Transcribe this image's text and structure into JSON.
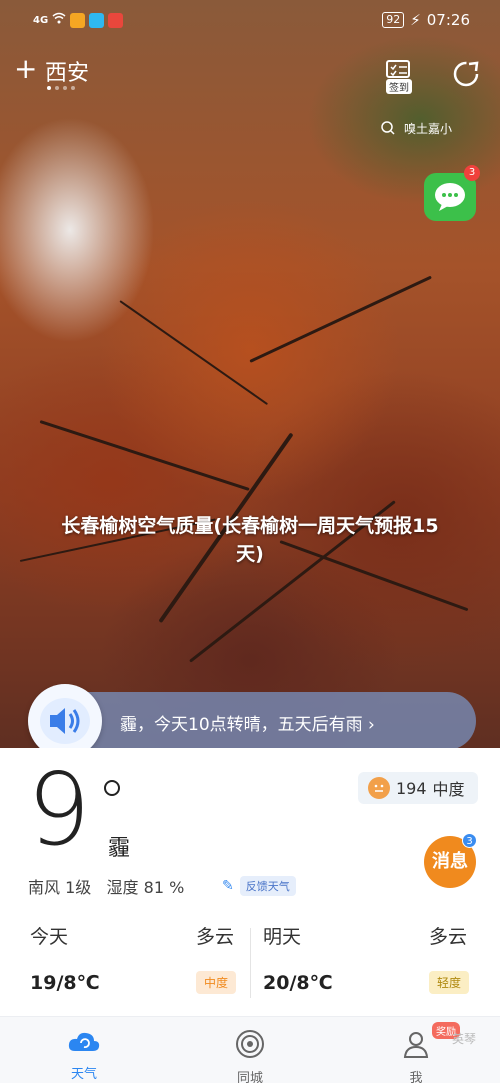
{
  "status_bar": {
    "signal": "4G",
    "battery": "92",
    "time": "07:26"
  },
  "header": {
    "add_symbol": "+",
    "city": "西安",
    "signin_label": "签到",
    "search_text": "嗅土嘉小",
    "chat_badge": "3"
  },
  "headline": "长春榆树空气质量(长春榆树一周天气预报15天)",
  "banner": {
    "text": "霾，今天10点转晴，五天后有雨 ›"
  },
  "current": {
    "temperature": "9",
    "condition": "霾",
    "aqi_value": "194",
    "aqi_level": "中度",
    "wind": "南风 1级",
    "humidity": "湿度 81 %",
    "feedback_label": "反馈天气",
    "message_label": "消息",
    "message_badge": "3"
  },
  "forecast": [
    {
      "day": "今天",
      "condition": "多云",
      "temps": "19/8℃",
      "aqi": "中度",
      "aqi_color": "#f08a1e",
      "aqi_bg": "#fde9d4"
    },
    {
      "day": "明天",
      "condition": "多云",
      "temps": "20/8℃",
      "aqi": "轻度",
      "aqi_color": "#b08a10",
      "aqi_bg": "#fbeec4"
    }
  ],
  "bottom_nav": {
    "items": [
      {
        "label": "天气",
        "icon": "weather-cloud-icon",
        "active": true
      },
      {
        "label": "同城",
        "icon": "nearby-icon",
        "active": false
      },
      {
        "label": "我",
        "icon": "profile-icon",
        "active": false
      }
    ],
    "vip_badge": "奖励",
    "watermark": "英琴"
  },
  "colors": {
    "accent": "#2b86f1",
    "message_orange": "#f08a1e",
    "chat_green": "#3cc04a"
  }
}
